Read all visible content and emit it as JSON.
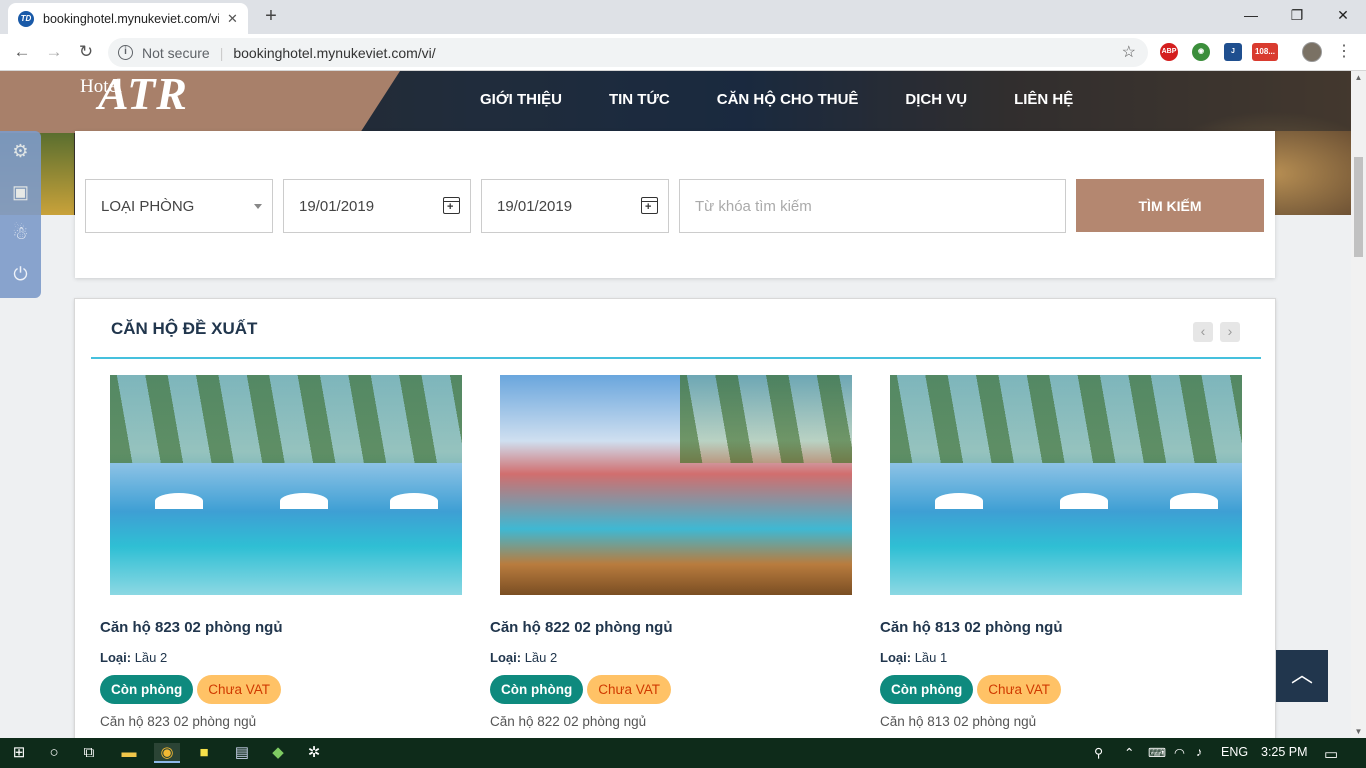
{
  "browser": {
    "tab_title": "bookinghotel.mynukeviet.com/vi/",
    "tab_favicon": "TD",
    "security_label": "Not secure",
    "url": "bookinghotel.mynukeviet.com/vi/",
    "extensions": [
      "ABP",
      "108..."
    ]
  },
  "header": {
    "logo_small": "Hotel",
    "logo_big": "ATR",
    "nav": [
      "GIỚI THIỆU",
      "TIN TỨC",
      "CĂN HỘ CHO THUÊ",
      "DỊCH VỤ",
      "LIÊN HỆ"
    ]
  },
  "search": {
    "room_type": "LOẠI PHÒNG",
    "checkin": "19/01/2019",
    "checkout": "19/01/2019",
    "keyword_placeholder": "Từ khóa tìm kiếm",
    "button": "TÌM KIẾM"
  },
  "suggest": {
    "title": "CĂN HỘ ĐỀ XUẤT",
    "type_label": "Loại:",
    "cards": [
      {
        "name": "Căn hộ 823 02 phòng ngủ",
        "type": "Lầu 2",
        "status": "Còn phòng",
        "vat": "Chưa VAT",
        "desc": "Căn hộ 823 02 phòng ngủ"
      },
      {
        "name": "Căn hộ 822 02 phòng ngủ",
        "type": "Lầu 2",
        "status": "Còn phòng",
        "vat": "Chưa VAT",
        "desc": "Căn hộ 822 02 phòng ngủ"
      },
      {
        "name": "Căn hộ 813 02 phòng ngủ",
        "type": "Lầu 1",
        "status": "Còn phòng",
        "vat": "Chưa VAT",
        "desc": "Căn hộ 813 02 phòng ngủ"
      }
    ]
  },
  "taskbar": {
    "language": "ENG",
    "time": "3:25 PM"
  },
  "colors": {
    "brand": "#b48770",
    "navy": "#21364d",
    "accent_line": "#45c0dd",
    "available": "#0e8a7e",
    "vat": "#ffc266"
  }
}
